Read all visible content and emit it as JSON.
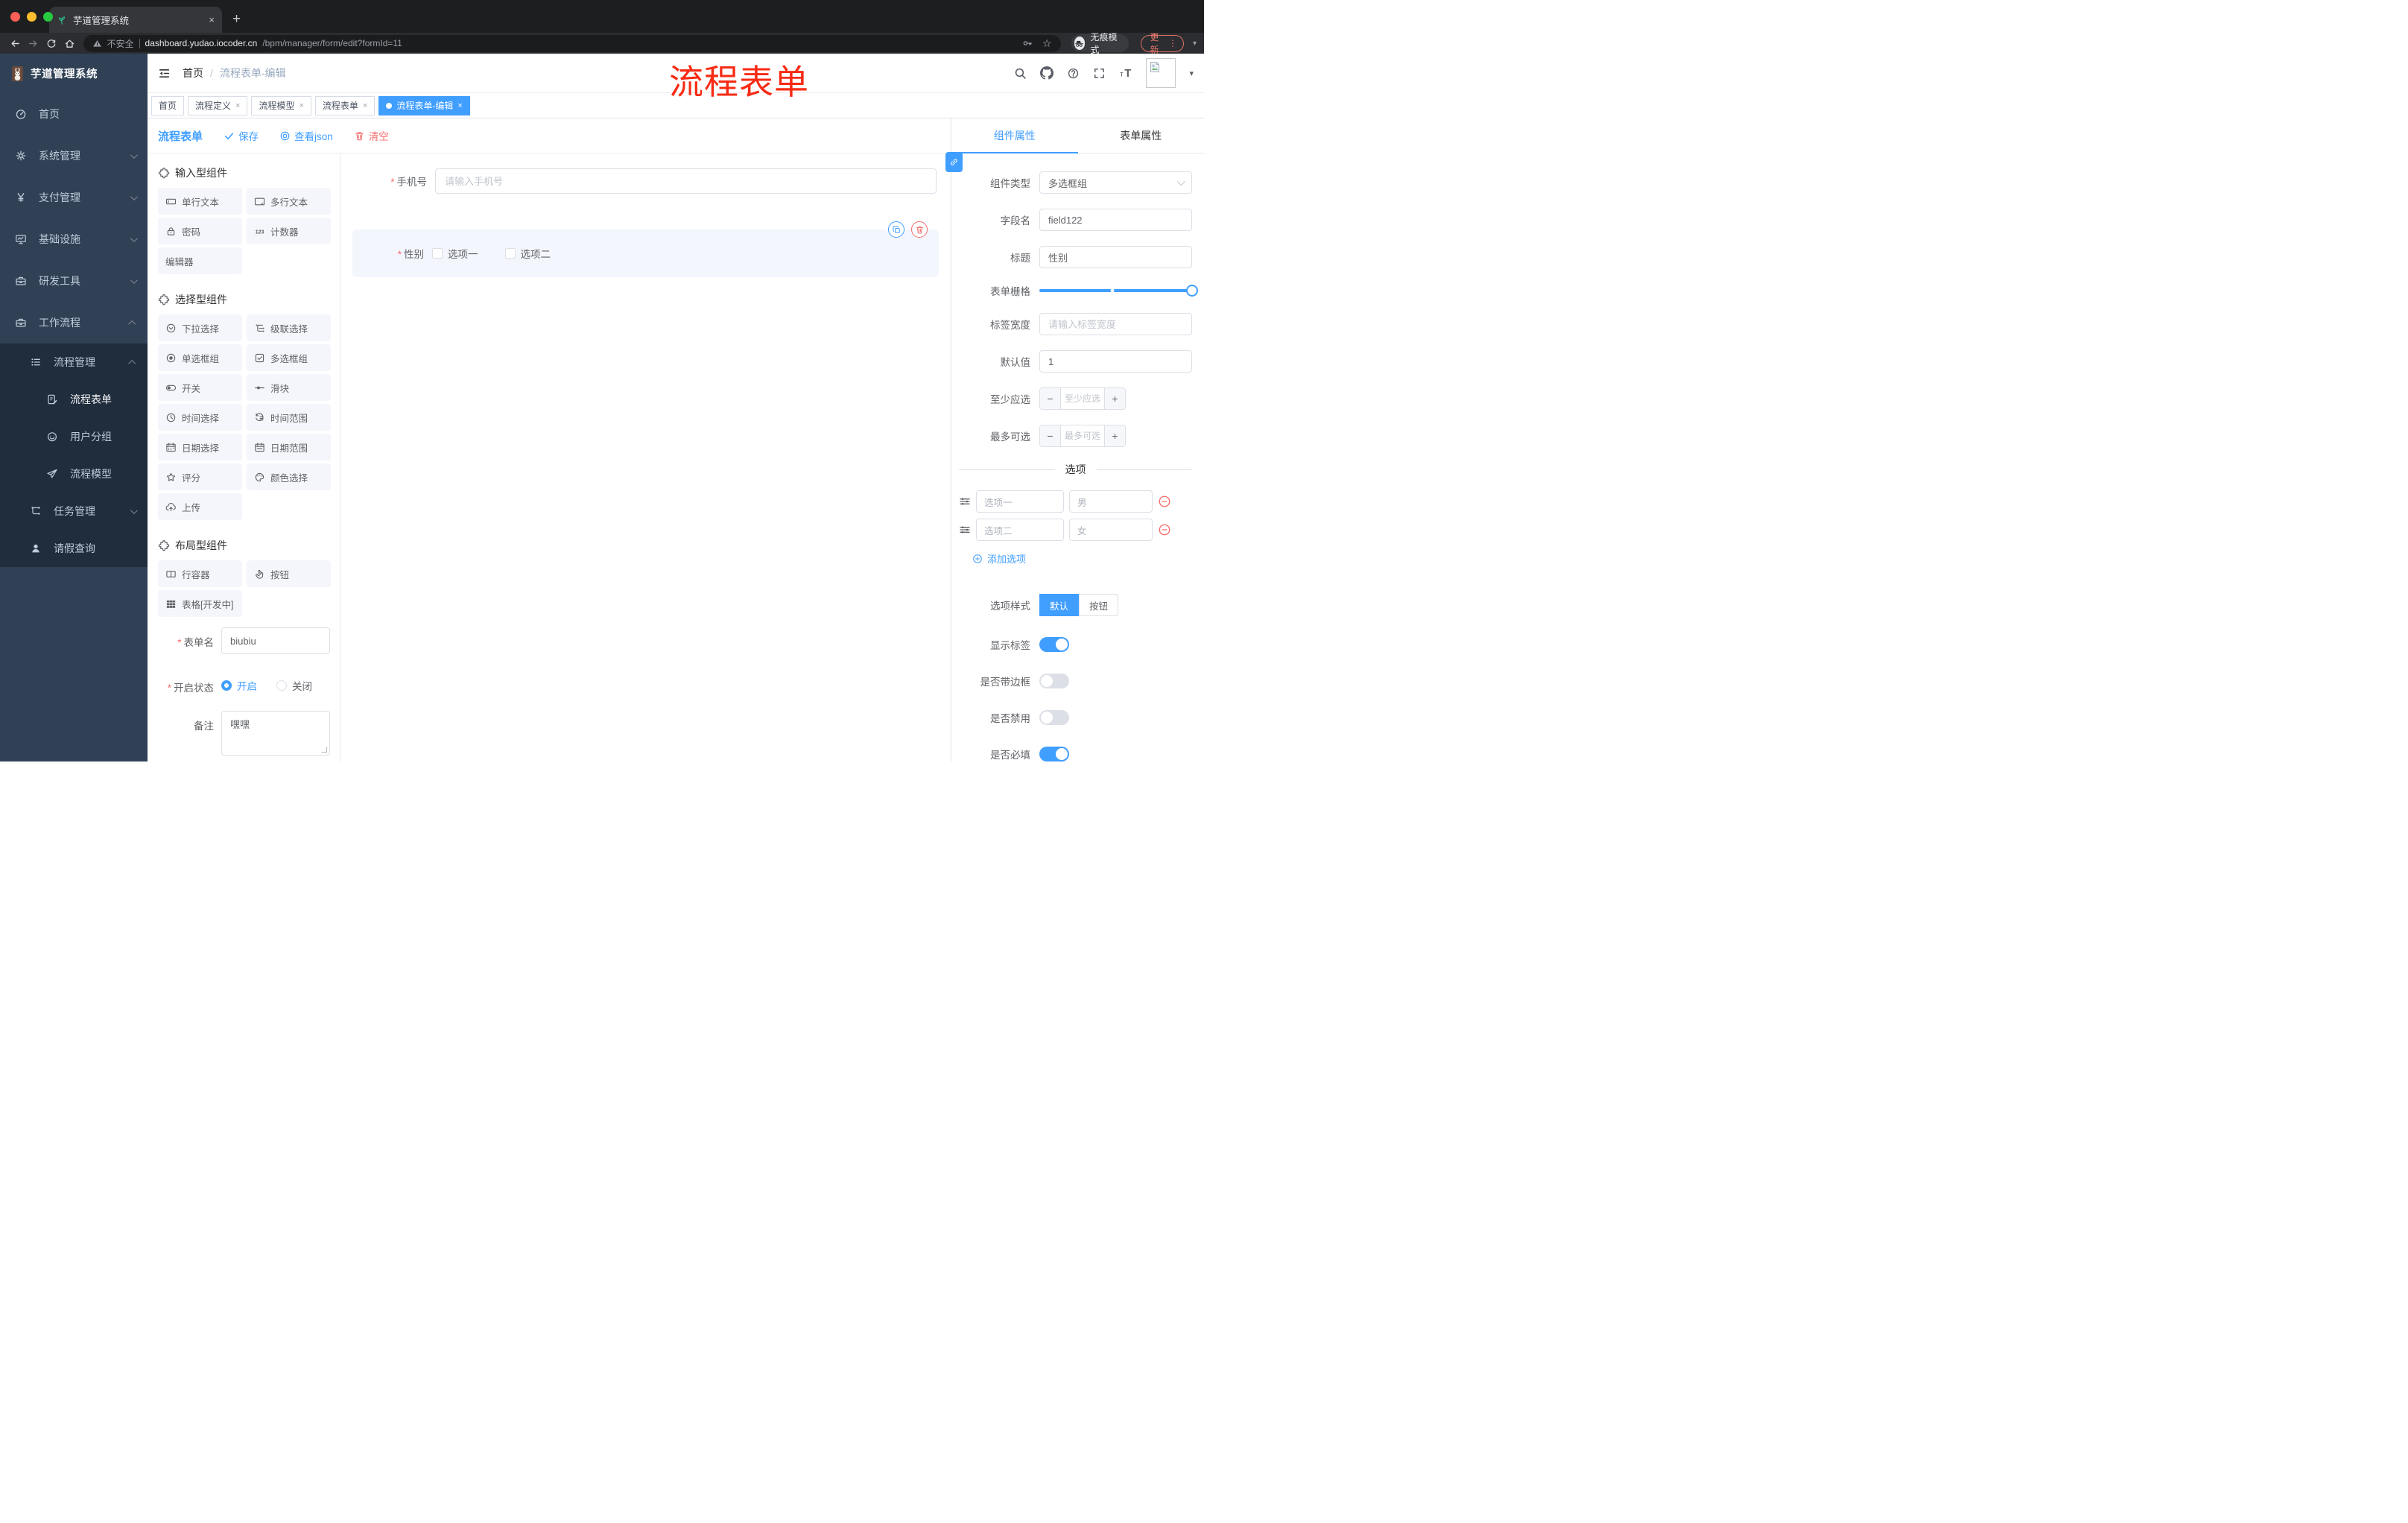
{
  "browser": {
    "tab_title": "芋道管理系统",
    "new_tab_glyph": "+",
    "close_glyph": "×",
    "security_label": "不安全",
    "url_host": "dashboard.yudao.iocoder.cn",
    "url_path": "/bpm/manager/form/edit?formId=11",
    "incognito_label": "无痕模式",
    "update_label": "更新",
    "menu_glyph": "⋮",
    "traffic_colors": [
      "#ff5f57",
      "#febc2e",
      "#28c840"
    ]
  },
  "header": {
    "logo_title": "芋道管理系统",
    "breadcrumb_home": "首页",
    "breadcrumb_sep": "/",
    "breadcrumb_current": "流程表单-编辑",
    "overlay_title": "流程表单",
    "caret_glyph": "▾"
  },
  "sidebar": {
    "items": [
      {
        "icon": "dashboard-icon",
        "label": "首页",
        "cls": "lv1",
        "arrow": ""
      },
      {
        "icon": "gear-icon",
        "label": "系统管理",
        "cls": "lv1",
        "arrow": "down"
      },
      {
        "icon": "yen-icon",
        "label": "支付管理",
        "cls": "lv1",
        "arrow": "down"
      },
      {
        "icon": "monitor-icon",
        "label": "基础设施",
        "cls": "lv1",
        "arrow": "down"
      },
      {
        "icon": "toolbox-icon",
        "label": "研发工具",
        "cls": "lv1",
        "arrow": "down"
      },
      {
        "icon": "briefcase-icon",
        "label": "工作流程",
        "cls": "lv1",
        "arrow": "up"
      },
      {
        "icon": "list-tree-icon",
        "label": "流程管理",
        "cls": "lv2 dark",
        "arrow": "up"
      },
      {
        "icon": "doc-edit-icon",
        "label": "流程表单",
        "cls": "lv3 dark active",
        "arrow": ""
      },
      {
        "icon": "face-icon",
        "label": "用户分组",
        "cls": "lv3 dark",
        "arrow": ""
      },
      {
        "icon": "send-icon",
        "label": "流程模型",
        "cls": "lv3 dark",
        "arrow": ""
      },
      {
        "icon": "flow-icon",
        "label": "任务管理",
        "cls": "lv2 dark",
        "arrow": "down"
      },
      {
        "icon": "person-icon",
        "label": "请假查询",
        "cls": "lv2 dark",
        "arrow": ""
      }
    ]
  },
  "tags": {
    "items": [
      {
        "label": "首页",
        "closable": "",
        "cls": ""
      },
      {
        "label": "流程定义",
        "closable": "×",
        "cls": ""
      },
      {
        "label": "流程模型",
        "closable": "×",
        "cls": ""
      },
      {
        "label": "流程表单",
        "closable": "×",
        "cls": ""
      },
      {
        "label": "流程表单-编辑",
        "closable": "×",
        "cls": "active"
      }
    ]
  },
  "toolbar": {
    "title": "流程表单",
    "save_label": "保存",
    "view_json_label": "查看json",
    "clear_label": "清空"
  },
  "components": {
    "groups": [
      {
        "title": "输入型组件",
        "items": [
          {
            "icon": "input-icon",
            "label": "单行文本"
          },
          {
            "icon": "textarea-icon",
            "label": "多行文本"
          },
          {
            "icon": "lock-icon",
            "label": "密码"
          },
          {
            "icon": "counter-icon",
            "label": "计数器"
          },
          {
            "icon": "",
            "label": "编辑器"
          }
        ]
      },
      {
        "title": "选择型组件",
        "items": [
          {
            "icon": "select-icon",
            "label": "下拉选择"
          },
          {
            "icon": "cascader-icon",
            "label": "级联选择"
          },
          {
            "icon": "radio-icon",
            "label": "单选框组"
          },
          {
            "icon": "checkbox-icon",
            "label": "多选框组"
          },
          {
            "icon": "switch-icon",
            "label": "开关"
          },
          {
            "icon": "slider-icon",
            "label": "滑块"
          },
          {
            "icon": "time-icon",
            "label": "时间选择"
          },
          {
            "icon": "time-range-icon",
            "label": "时间范围"
          },
          {
            "icon": "date-icon",
            "label": "日期选择"
          },
          {
            "icon": "date-range-icon",
            "label": "日期范围"
          },
          {
            "icon": "star-icon",
            "label": "评分"
          },
          {
            "icon": "palette-icon",
            "label": "颜色选择"
          },
          {
            "icon": "upload-icon",
            "label": "上传"
          }
        ]
      },
      {
        "title": "布局型组件",
        "items": [
          {
            "icon": "columns-icon",
            "label": "行容器"
          },
          {
            "icon": "hand-icon",
            "label": "按钮"
          },
          {
            "icon": "grid-icon",
            "label": "表格[开发中]"
          }
        ]
      }
    ]
  },
  "form_meta": {
    "name_label": "表单名",
    "name_value": "biubiu",
    "status_label": "开启状态",
    "status_on": "开启",
    "status_off": "关闭",
    "remark_label": "备注",
    "remark_value": "嘿嘿"
  },
  "canvas": {
    "phone_label": "手机号",
    "phone_placeholder": "请输入手机号",
    "gender_label": "性别",
    "gender_options": [
      "选项一",
      "选项二"
    ]
  },
  "props": {
    "tab_component": "组件属性",
    "tab_form": "表单属性",
    "type_label": "组件类型",
    "type_value": "多选框组",
    "field_label": "字段名",
    "field_value": "field122",
    "title_label": "标题",
    "title_value": "性别",
    "grid_label": "表单栅格",
    "width_label": "标签宽度",
    "width_placeholder": "请输入标签宽度",
    "default_label": "默认值",
    "default_value": "1",
    "min_label": "至少应选",
    "min_placeholder": "至少应选",
    "minus_glyph": "−",
    "plus_glyph": "+",
    "max_label": "最多可选",
    "max_placeholder": "最多可选",
    "options_title": "选项",
    "options": [
      {
        "label": "选项一",
        "value": "男"
      },
      {
        "label": "选项二",
        "value": "女"
      }
    ],
    "add_option_label": "添加选项",
    "style_label": "选项样式",
    "style_options": [
      {
        "label": "默认",
        "cls": "active"
      },
      {
        "label": "按钮",
        "cls": ""
      }
    ],
    "switches": [
      {
        "label": "显示标签",
        "cls": "on"
      },
      {
        "label": "是否带边框",
        "cls": ""
      },
      {
        "label": "是否禁用",
        "cls": ""
      },
      {
        "label": "是否必填",
        "cls": "on"
      }
    ]
  },
  "colors": {
    "primary": "#409eff",
    "danger": "#f56c6c",
    "annotation": "#f72b14",
    "sidebar_bg": "#304156",
    "sidebar_sub_bg": "#1f2d3d"
  }
}
